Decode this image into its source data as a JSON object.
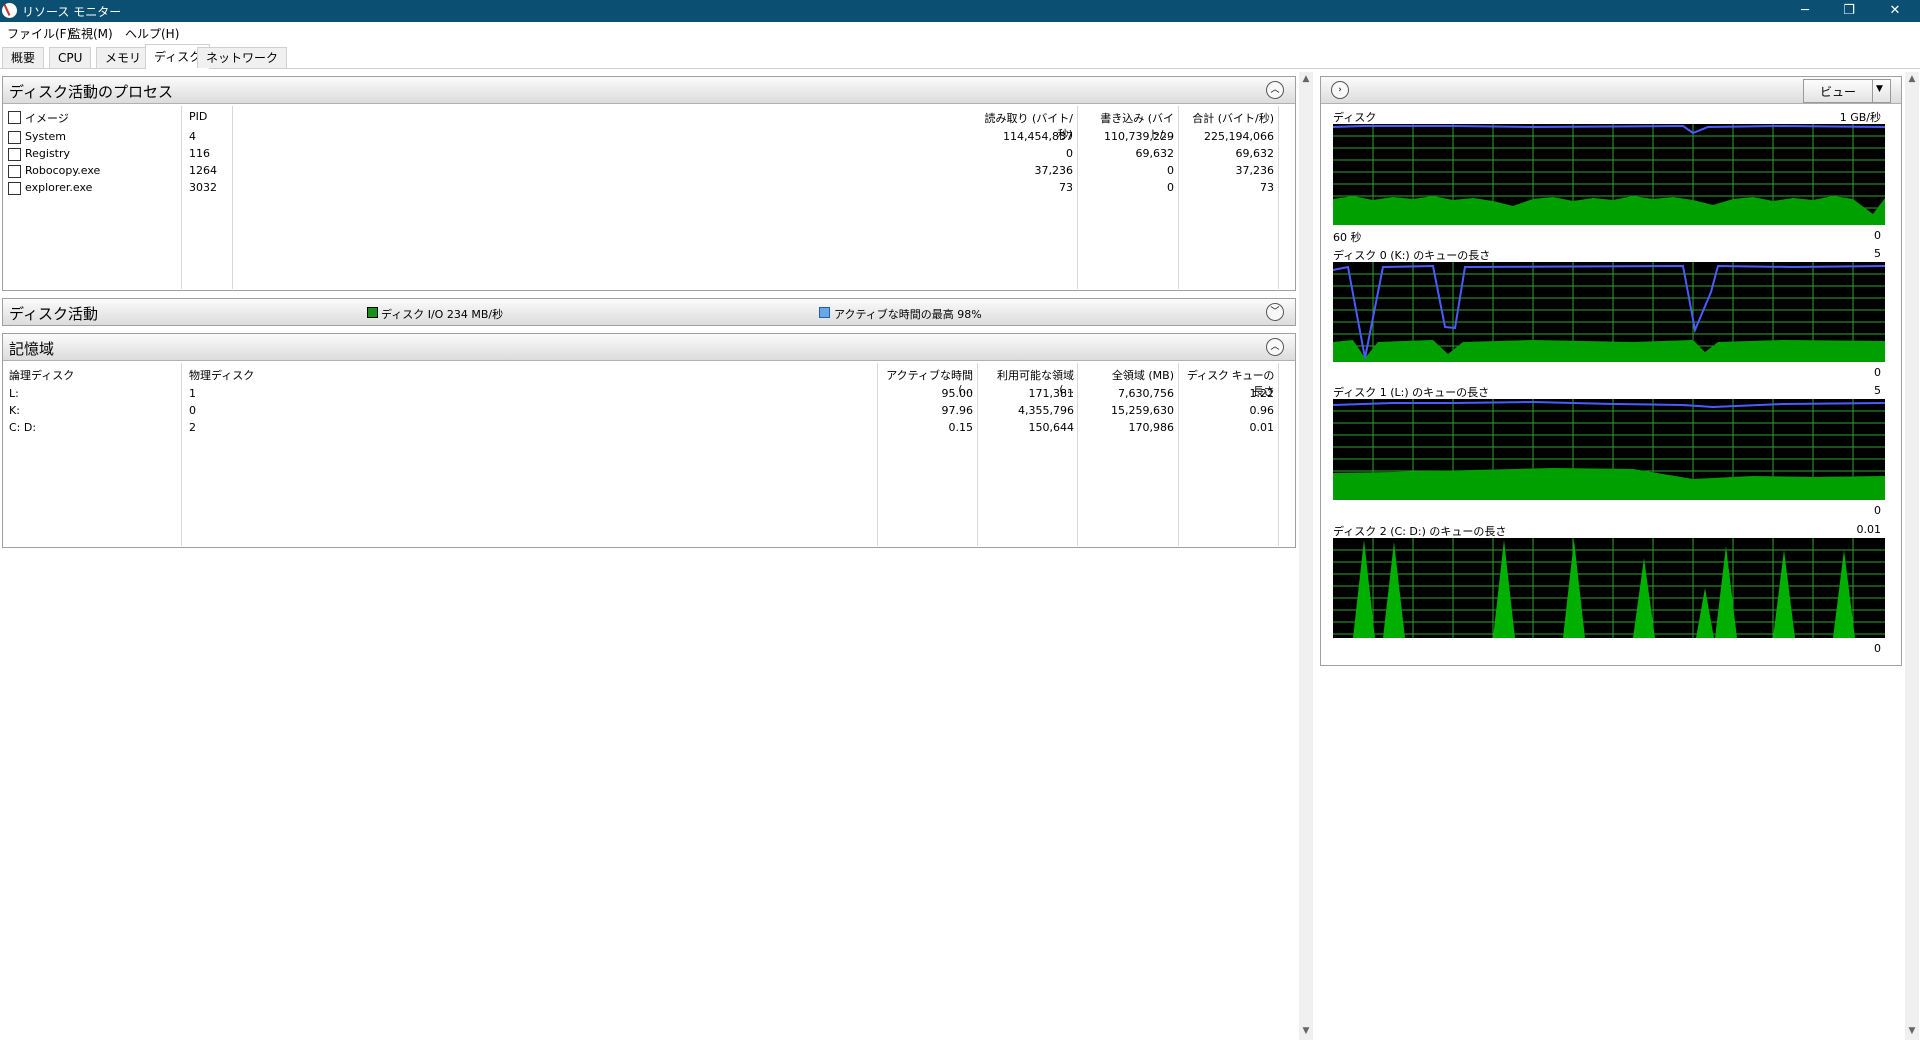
{
  "window": {
    "title": "リソース モニター",
    "buttons": [
      "─",
      "❐",
      "✕"
    ]
  },
  "menu": [
    "ファイル(F)",
    "監視(M)",
    "ヘルプ(H)"
  ],
  "tabs": [
    {
      "label": "概要",
      "active": false
    },
    {
      "label": "CPU",
      "active": false
    },
    {
      "label": "メモリ",
      "active": false
    },
    {
      "label": "ディスク",
      "active": true
    },
    {
      "label": "ネットワーク",
      "active": false
    }
  ],
  "processes": {
    "title": "ディスク活動のプロセス",
    "columns": [
      "イメージ",
      "PID",
      "読み取り (バイト/秒)",
      "書き込み (バイト/...",
      "合計 (バイト/秒)"
    ],
    "rows": [
      {
        "image": "System",
        "pid": "4",
        "read": "114,454,837",
        "write": "110,739,229",
        "total": "225,194,066"
      },
      {
        "image": "Registry",
        "pid": "116",
        "read": "0",
        "write": "69,632",
        "total": "69,632"
      },
      {
        "image": "Robocopy.exe",
        "pid": "1264",
        "read": "37,236",
        "write": "0",
        "total": "37,236"
      },
      {
        "image": "explorer.exe",
        "pid": "3032",
        "read": "73",
        "write": "0",
        "total": "73"
      }
    ]
  },
  "activity": {
    "title": "ディスク活動",
    "io_legend": "ディスク I/O 234 MB/秒",
    "active_legend": "アクティブな時間の最高 98%",
    "io_color": "#1a8f1a",
    "active_color": "#6aa7e8"
  },
  "storage": {
    "title": "記憶域",
    "columns": [
      "論理ディスク",
      "物理ディスク",
      "アクティブな時間 (...",
      "利用可能な領域 (...",
      "全領域 (MB)",
      "ディスク キューの長さ"
    ],
    "rows": [
      {
        "logical": "L:",
        "physical": "1",
        "active": "95.00",
        "available": "171,381",
        "total": "7,630,756",
        "queue": "1.22"
      },
      {
        "logical": "K:",
        "physical": "0",
        "active": "97.96",
        "available": "4,355,796",
        "total": "15,259,630",
        "queue": "0.96"
      },
      {
        "logical": "C: D:",
        "physical": "2",
        "active": "0.15",
        "available": "150,644",
        "total": "170,986",
        "queue": "0.01"
      }
    ]
  },
  "graphs": {
    "view_label": "ビュー",
    "panels": [
      {
        "label": "ディスク",
        "top_value": "1 GB/秒",
        "bottom_left": "60 秒",
        "bottom_right": "0"
      },
      {
        "label": "ディスク 0 (K:) のキューの長さ",
        "top_value": "5",
        "bottom_left": "",
        "bottom_right": "0"
      },
      {
        "label": "ディスク 1 (L:) のキューの長さ",
        "top_value": "5",
        "bottom_left": "",
        "bottom_right": "0"
      },
      {
        "label": "ディスク 2 (C: D:) のキューの長さ",
        "top_value": "0.01",
        "bottom_left": "",
        "bottom_right": "0"
      }
    ],
    "line_color": "#4a5cff",
    "fill_color": "#00a000",
    "grid_color": "#2fa32f"
  }
}
